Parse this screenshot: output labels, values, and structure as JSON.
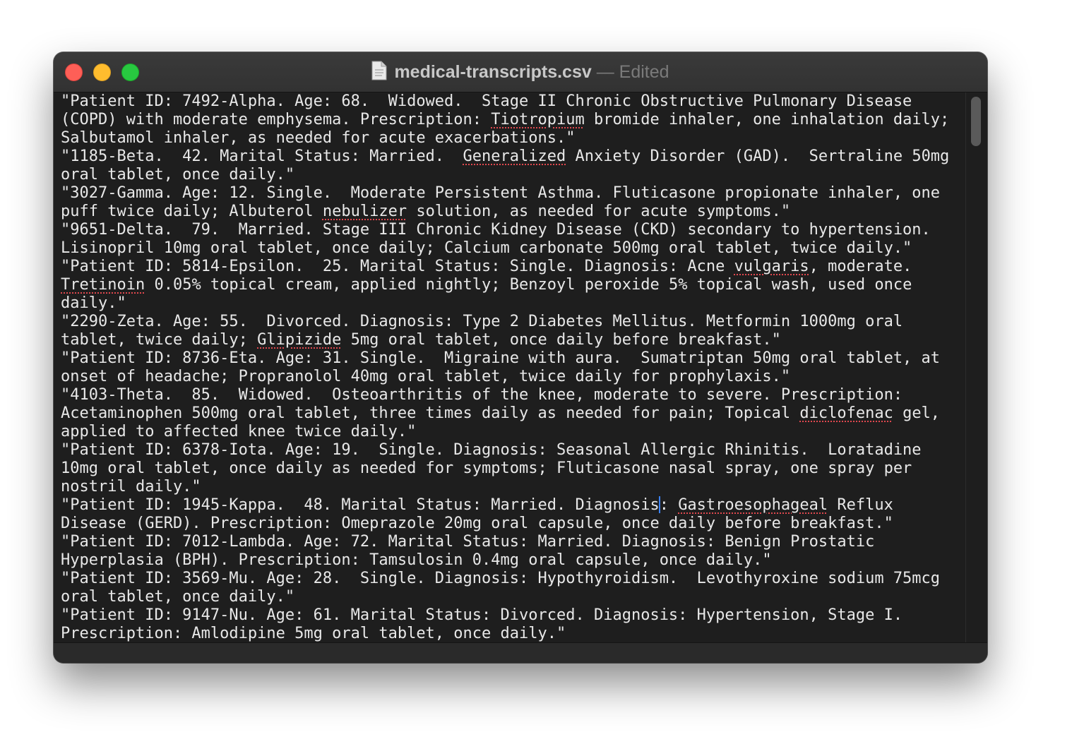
{
  "window": {
    "file_name": "medical-transcripts.csv",
    "separator": "—",
    "status": "Edited"
  },
  "icons": {
    "close": "close-button",
    "minimize": "minimize-button",
    "zoom": "zoom-button",
    "document": "document-icon"
  },
  "colors": {
    "editor_background": "#1e1e1e",
    "text": "#e8e8e8",
    "caret": "#3b82f6",
    "spellcheck_underline": "#e0484e"
  },
  "lines": [
    "\"Patient ID: 7492-Alpha. Age: 68.  Widowed.  Stage II Chronic Obstructive Pulmonary Disease",
    "(COPD) with moderate emphysema. Prescription: [[Tiotropium]] bromide inhaler, one inhalation daily;",
    "Salbutamol inhaler, as needed for acute exacerbations.\"",
    "\"1185-Beta.  42. Marital Status: Married.  [[Generalized]] Anxiety Disorder (GAD).  Sertraline 50mg",
    "oral tablet, once daily.\"",
    "\"3027-Gamma. Age: 12. Single.  Moderate Persistent Asthma. Fluticasone propionate inhaler, one",
    "puff twice daily; Albuterol [[nebulizer]] solution, as needed for acute symptoms.\"",
    "\"9651-Delta.  79.  Married. Stage III Chronic Kidney Disease (CKD) secondary to hypertension.",
    "Lisinopril 10mg oral tablet, once daily; Calcium carbonate 500mg oral tablet, twice daily.\"",
    "\"Patient ID: 5814-Epsilon.  25. Marital Status: Single. Diagnosis: Acne [[vulgaris]], moderate.",
    "[[Tretinoin]] 0.05% topical cream, applied nightly; Benzoyl peroxide 5% topical wash, used once",
    "daily.\"",
    "\"2290-Zeta. Age: 55.  Divorced. Diagnosis: Type 2 Diabetes Mellitus. Metformin 1000mg oral",
    "tablet, twice daily; [[Glipizide]] 5mg oral tablet, once daily before breakfast.\"",
    "\"Patient ID: 8736-Eta. Age: 31. Single.  Migraine with aura.  Sumatriptan 50mg oral tablet, at",
    "onset of headache; Propranolol 40mg oral tablet, twice daily for prophylaxis.\"",
    "\"4103-Theta.  85.  Widowed.  Osteoarthritis of the knee, moderate to severe. Prescription:",
    "Acetaminophen 500mg oral tablet, three times daily as needed for pain; Topical [[diclofenac]] gel,",
    "applied to affected knee twice daily.\"",
    "\"Patient ID: 6378-Iota. Age: 19.  Single. Diagnosis: Seasonal Allergic Rhinitis.  Loratadine",
    "10mg oral tablet, once daily as needed for symptoms; Fluticasone nasal spray, one spray per",
    "nostril daily.\"",
    "\"Patient ID: 1945-Kappa.  48. Marital Status: Married. Diagnosis|: [[Gastroesophageal]] Reflux",
    "Disease (GERD). Prescription: Omeprazole 20mg oral capsule, once daily before breakfast.\"",
    "\"Patient ID: 7012-Lambda. Age: 72. Marital Status: Married. Diagnosis: Benign Prostatic",
    "Hyperplasia (BPH). Prescription: Tamsulosin 0.4mg oral capsule, once daily.\"",
    "\"Patient ID: 3569-Mu. Age: 28.  Single. Diagnosis: Hypothyroidism.  Levothyroxine sodium 75mcg",
    "oral tablet, once daily.\"",
    "\"Patient ID: 9147-Nu. Age: 61. Marital Status: Divorced. Diagnosis: Hypertension, Stage I.",
    "Prescription: Amlodipine 5mg oral tablet, once daily.\""
  ]
}
